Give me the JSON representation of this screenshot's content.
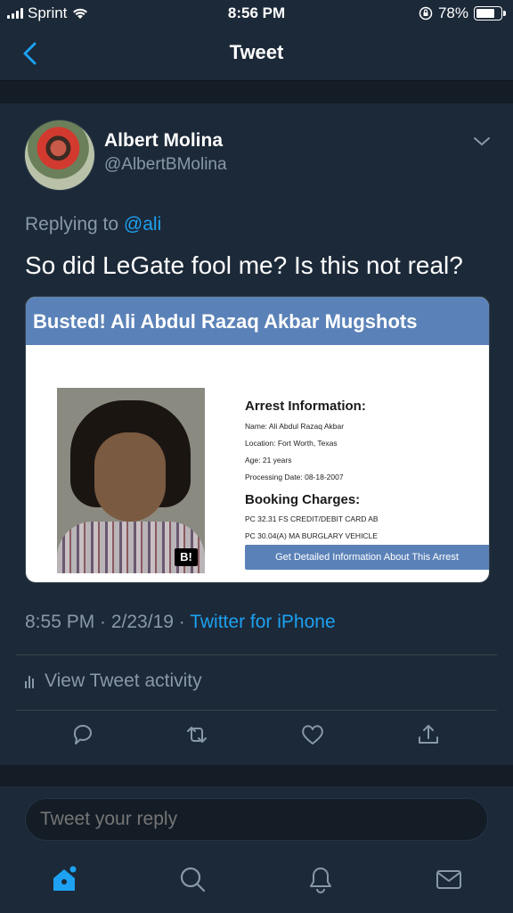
{
  "status_bar": {
    "carrier": "Sprint",
    "time": "8:56 PM",
    "battery": "78%",
    "battery_level": 0.78,
    "icons": [
      "signal-icon",
      "wifi-icon",
      "rotation-lock-icon",
      "battery-icon"
    ]
  },
  "nav": {
    "title": "Tweet",
    "back_icon": "chevron-left-icon"
  },
  "tweet": {
    "author_name": "Albert Molina",
    "author_handle": "@AlbertBMolina",
    "replying_prefix": "Replying to",
    "replying_mention": "@ali",
    "text": "So did LeGate fool me? Is this not real?",
    "timestamp": "8:55 PM · 2/23/19 · ",
    "source": "Twitter for iPhone",
    "activity_label": "View Tweet activity"
  },
  "card": {
    "title": "Busted! Ali Abdul Razaq Akbar Mugshots",
    "arrest_heading": "Arrest Information:",
    "arrest_lines": [
      "Name: Ali Abdul Razaq Akbar",
      "Location: Fort Worth, Texas",
      "Age: 21 years",
      "Processing Date: 08-18-2007"
    ],
    "charges_heading": "Booking Charges:",
    "charges": [
      "PC 32.31 FS CREDIT/DEBIT CARD AB",
      "PC 30.04(A) MA BURGLARY VEHICLE"
    ],
    "button_label": "Get Detailed Information About This Arrest",
    "watermark": "B!"
  },
  "actions": [
    "reply-icon",
    "retweet-icon",
    "like-icon",
    "share-icon"
  ],
  "reply": {
    "placeholder": "Tweet your reply"
  },
  "tabs": [
    "home-icon",
    "search-icon",
    "notifications-icon",
    "messages-icon"
  ],
  "colors": {
    "background": "#141d26",
    "surface": "#1c2938",
    "accent": "#1da1f2",
    "muted": "#8899a6",
    "card_header": "#5b82b8"
  }
}
